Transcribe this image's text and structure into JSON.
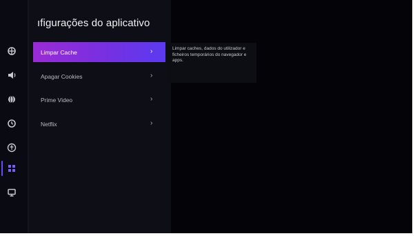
{
  "header": {
    "title": "ıfigurações do aplicativo"
  },
  "sidebar": {
    "items": [
      {
        "icon": "grid-globe-icon"
      },
      {
        "icon": "speaker-icon"
      },
      {
        "icon": "globe-icon"
      },
      {
        "icon": "timer-icon"
      },
      {
        "icon": "accessibility-icon"
      },
      {
        "icon": "apps-icon",
        "active": true
      },
      {
        "icon": "monitor-icon"
      }
    ]
  },
  "menu": {
    "items": [
      {
        "label": "Limpar Cache",
        "selected": true
      },
      {
        "label": "Apagar Cookies"
      },
      {
        "label": "Prime Video"
      },
      {
        "label": "Netflix"
      }
    ]
  },
  "description": {
    "text": "Limpar caches, dados do utilizador e ficheiros temporários do navegador e apps."
  },
  "colors": {
    "background": "#040408",
    "panel": "#0e0e16",
    "selected_gradient_start": "#9a2bd6",
    "selected_gradient_end": "#5b3af0",
    "active_icon": "#7b5cff"
  }
}
